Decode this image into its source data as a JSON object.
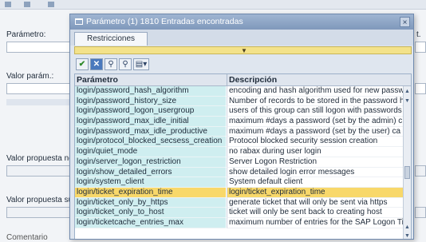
{
  "background": {
    "labels": {
      "parametro": "Parámetro:",
      "valor_param": "Valor parám.:",
      "valor_propuesta_no": "Valor propuesta no",
      "valor_propuesta_sus": "Valor propuesta sus",
      "bottom_fragment": "Comentario",
      "right_fragment": "t."
    }
  },
  "dialog": {
    "title": "Parámetro (1) 1810 Entradas encontradas",
    "close_glyph": "×",
    "tab_label": "Restricciones",
    "collapse_glyph": "▼",
    "toolbar": {
      "ok_glyph": "✔",
      "cancel_glyph": "✕",
      "find_glyph": "⚲",
      "find_next_glyph": "⚲",
      "print_glyph": "▤▾"
    },
    "table": {
      "headers": [
        "Parámetro",
        "Descripción"
      ],
      "selected_index": 10,
      "rows": [
        {
          "param": "login/password_hash_algorithm",
          "desc": "encoding and hash algorithm used for new passwo"
        },
        {
          "param": "login/password_history_size",
          "desc": "Number of records to be stored in the password h"
        },
        {
          "param": "login/password_logon_usergroup",
          "desc": "users of this group can still logon with passwords"
        },
        {
          "param": "login/password_max_idle_initial",
          "desc": "maximum #days a password (set by the admin) c"
        },
        {
          "param": "login/password_max_idle_productive",
          "desc": "maximum #days a password (set by the user) ca"
        },
        {
          "param": "login/protocol_blocked_secsess_creation",
          "desc": "Protocol blocked security session creation"
        },
        {
          "param": "login/quiet_mode",
          "desc": "no rabax during user login"
        },
        {
          "param": "login/server_logon_restriction",
          "desc": "Server Logon Restriction"
        },
        {
          "param": "login/show_detailed_errors",
          "desc": "show detailed login error messages"
        },
        {
          "param": "login/system_client",
          "desc": "System default client"
        },
        {
          "param": "login/ticket_expiration_time",
          "desc": "login/ticket_expiration_time"
        },
        {
          "param": "login/ticket_only_by_https",
          "desc": "generate ticket that will only be sent via https"
        },
        {
          "param": "login/ticket_only_to_host",
          "desc": "ticket will only be sent back to creating host"
        },
        {
          "param": "login/ticketcache_entries_max",
          "desc": "maximum number of entries for the SAP Logon Tick"
        }
      ]
    },
    "scroll": {
      "up_glyph": "▲",
      "down_glyph": "▼"
    }
  }
}
